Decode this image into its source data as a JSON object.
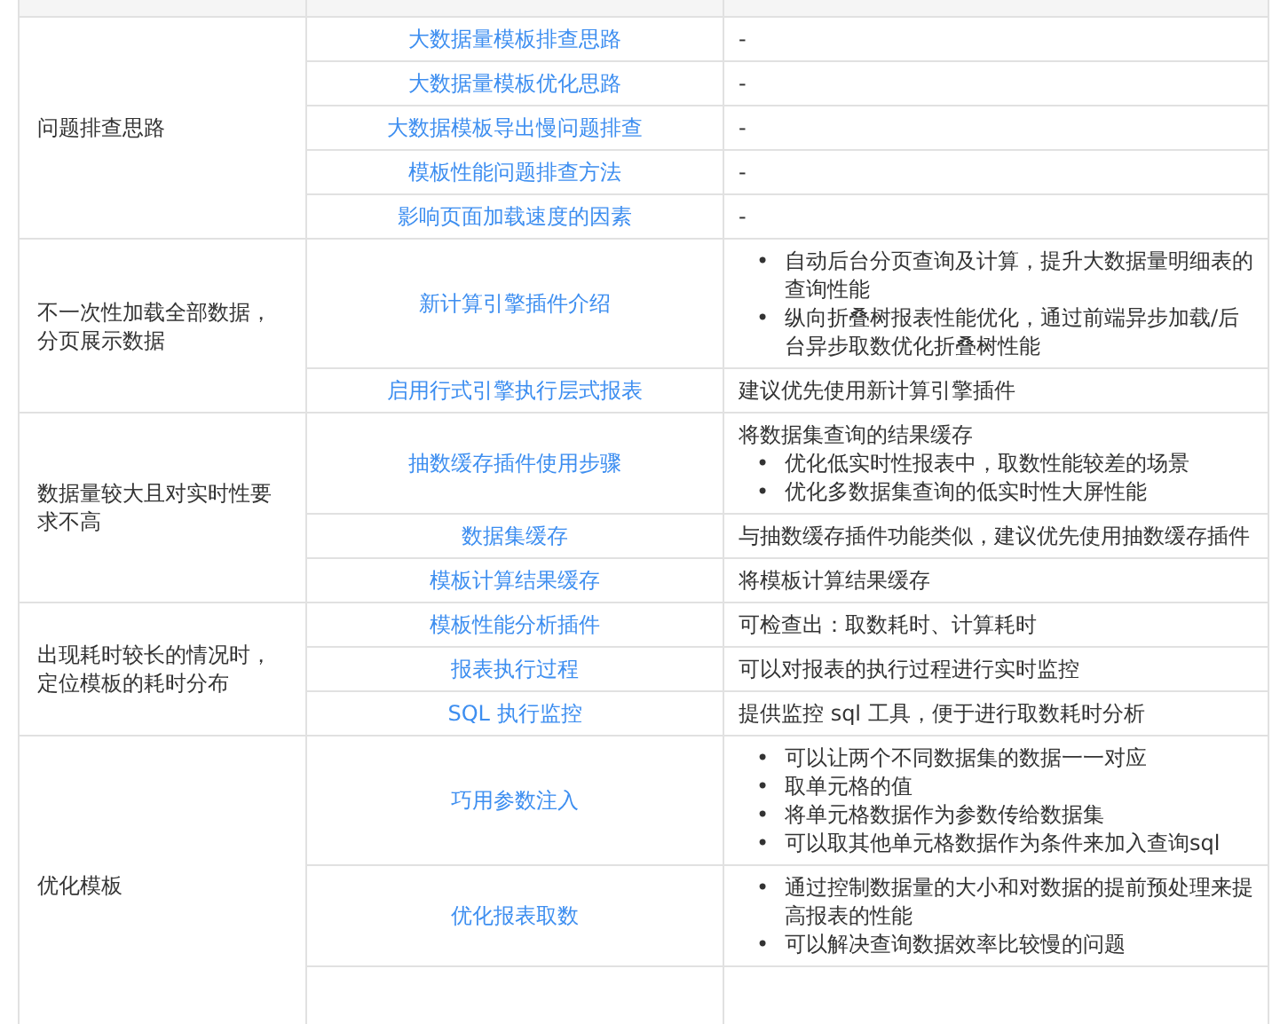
{
  "bullet_marker": "•",
  "groups": [
    {
      "scenario": "问题排查思路",
      "rows": [
        {
          "doc": "大数据量模板排查思路",
          "note": {
            "text": "-"
          }
        },
        {
          "doc": "大数据量模板优化思路",
          "note": {
            "text": "-"
          }
        },
        {
          "doc": "大数据模板导出慢问题排查",
          "note": {
            "text": "-"
          }
        },
        {
          "doc": "模板性能问题排查方法",
          "note": {
            "text": "-"
          }
        },
        {
          "doc": "影响页面加载速度的因素",
          "note": {
            "text": "-"
          }
        }
      ]
    },
    {
      "scenario": "不一次性加载全部数据，分页展示数据",
      "rows": [
        {
          "doc": "新计算引擎插件介绍",
          "note": {
            "bullets": [
              "自动后台分页查询及计算，提升大数据量明细表的查询性能",
              "纵向折叠树报表性能优化，通过前端异步加载/后台异步取数优化折叠树性能"
            ]
          }
        },
        {
          "doc": "启用行式引擎执行层式报表",
          "note": {
            "text": "建议优先使用新计算引擎插件"
          }
        }
      ]
    },
    {
      "scenario": "数据量较大且对实时性要求不高",
      "rows": [
        {
          "doc": "抽数缓存插件使用步骤",
          "note": {
            "text": "将数据集查询的结果缓存",
            "bullets": [
              "优化低实时性报表中，取数性能较差的场景",
              "优化多数据集查询的低实时性大屏性能"
            ]
          }
        },
        {
          "doc": "数据集缓存",
          "note": {
            "text": "与抽数缓存插件功能类似，建议优先使用抽数缓存插件"
          }
        },
        {
          "doc": "模板计算结果缓存",
          "note": {
            "text": "将模板计算结果缓存"
          }
        }
      ]
    },
    {
      "scenario": "出现耗时较长的情况时，定位模板的耗时分布",
      "rows": [
        {
          "doc": "模板性能分析插件",
          "note": {
            "text": "可检查出：取数耗时、计算耗时"
          }
        },
        {
          "doc": "报表执行过程",
          "note": {
            "text": "可以对报表的执行过程进行实时监控"
          }
        },
        {
          "doc": "SQL 执行监控",
          "note": {
            "text": "提供监控 sql 工具，便于进行取数耗时分析"
          }
        }
      ]
    },
    {
      "scenario": "优化模板",
      "rows": [
        {
          "doc": "巧用参数注入",
          "note": {
            "bullets": [
              "可以让两个不同数据集的数据一一对应",
              "取单元格的值",
              "将单元格数据作为参数传给数据集",
              "可以取其他单元格数据作为条件来加入查询sql"
            ]
          }
        },
        {
          "doc": "优化报表取数",
          "note": {
            "bullets": [
              "通过控制数据量的大小和对数据的提前预处理来提高报表的性能",
              "可以解决查询数据效率比较慢的问题"
            ]
          }
        },
        {}
      ]
    }
  ]
}
